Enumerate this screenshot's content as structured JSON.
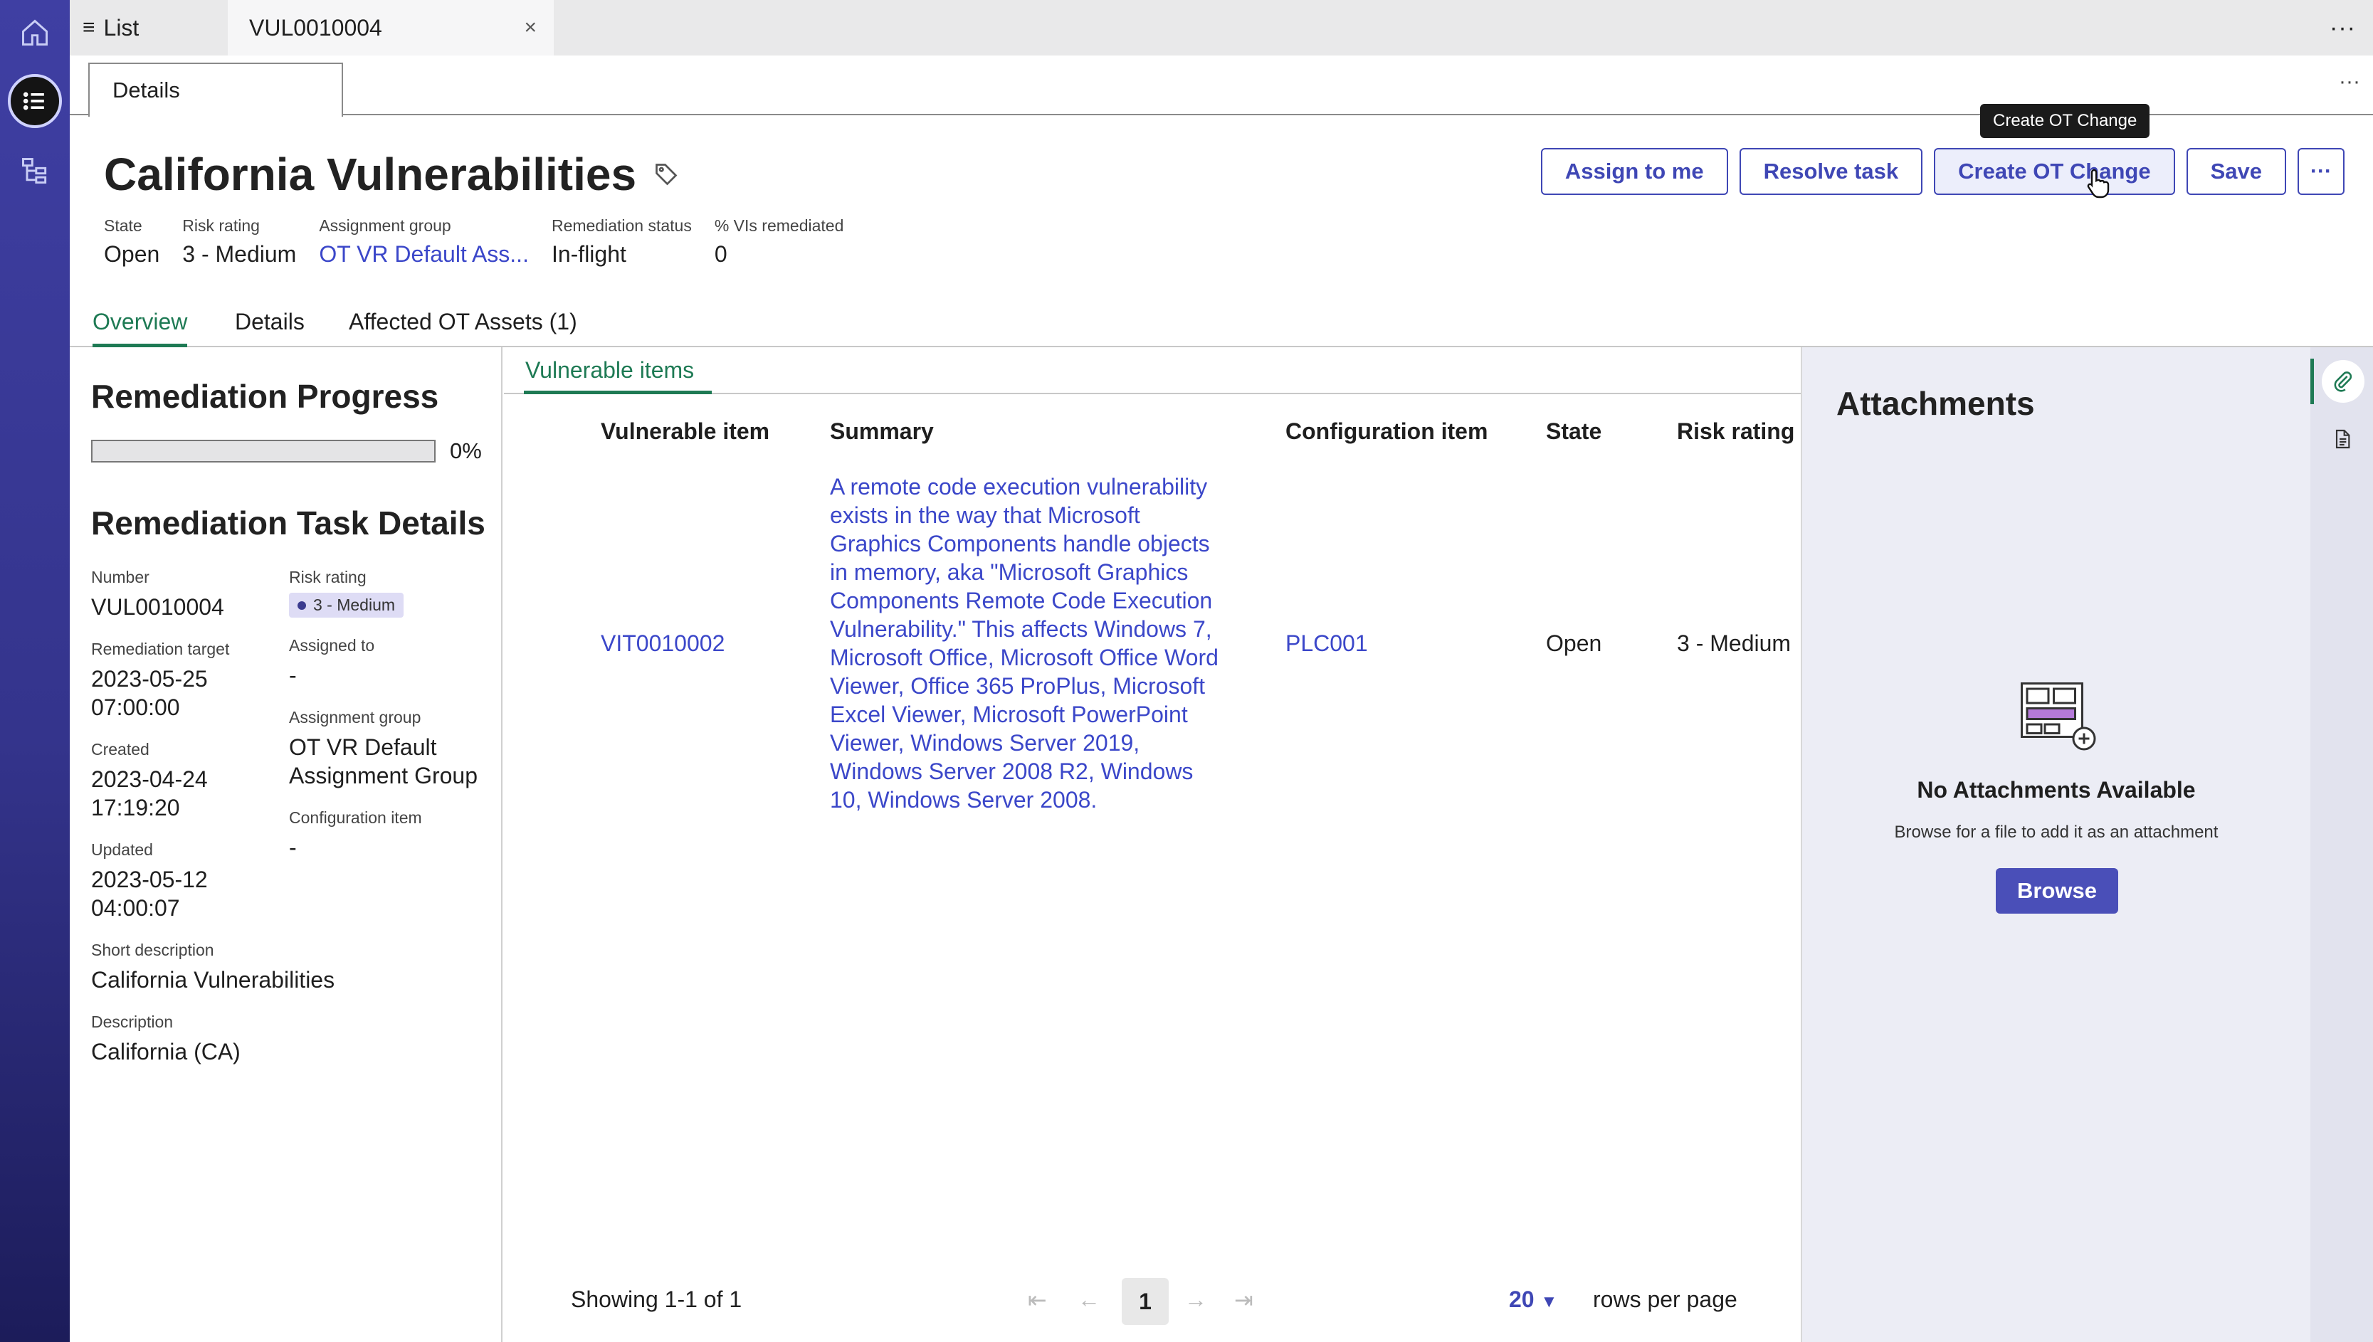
{
  "rail": {
    "items": [
      "home-icon",
      "list-icon",
      "hierarchy-icon"
    ]
  },
  "top_tabs": {
    "list_label": "List",
    "record_label": "VUL0010004",
    "close_glyph": "×",
    "more_glyph": "···"
  },
  "sub_tabs": {
    "details_label": "Details",
    "more_glyph": "···"
  },
  "header": {
    "title": "California Vulnerabilities",
    "fields": [
      {
        "label": "State",
        "value": "Open"
      },
      {
        "label": "Risk rating",
        "value": "3 - Medium"
      },
      {
        "label": "Assignment group",
        "value": "OT VR Default Ass..."
      },
      {
        "label": "Remediation status",
        "value": "In-flight"
      },
      {
        "label": "% VIs remediated",
        "value": "0"
      }
    ]
  },
  "actions": {
    "assign": "Assign to me",
    "resolve": "Resolve task",
    "create_change": "Create OT Change",
    "save": "Save",
    "more": "···",
    "tooltip": "Create OT Change"
  },
  "record_tabs": [
    "Overview",
    "Details",
    "Affected OT Assets (1)"
  ],
  "progress": {
    "title": "Remediation Progress",
    "fraction": 0,
    "percent_label": "0%"
  },
  "task_details": {
    "title": "Remediation Task Details",
    "number_label": "Number",
    "number": "VUL0010004",
    "risk_label": "Risk rating",
    "risk": "3 - Medium",
    "target_label": "Remediation target",
    "target_date": "2023-05-25",
    "target_time": "07:00:00",
    "assigned_label": "Assigned to",
    "assigned": "-",
    "created_label": "Created",
    "created_date": "2023-04-24",
    "created_time": "17:19:20",
    "group_label": "Assignment group",
    "group_line1": "OT VR Default",
    "group_line2": "Assignment Group",
    "ci_label": "Configuration item",
    "ci": "-",
    "updated_label": "Updated",
    "updated_date": "2023-05-12",
    "updated_time": "04:00:07",
    "short_desc_label": "Short description",
    "short_desc": "California Vulnerabilities",
    "desc_label": "Description",
    "desc": "California (CA)"
  },
  "vuln_table": {
    "tab_label": "Vulnerable items",
    "columns": [
      "Vulnerable item",
      "Summary",
      "Configuration item",
      "State",
      "Risk rating"
    ],
    "rows": [
      {
        "item": "VIT0010002",
        "summary": "A remote code execution vulnerability exists in the way that Microsoft Graphics Components handle objects in memory, aka \"Microsoft Graphics Components Remote Code Execution Vulnerability.\" This affects Windows 7, Microsoft Office, Microsoft Office Word Viewer, Office 365 ProPlus, Microsoft Excel Viewer, Microsoft PowerPoint Viewer, Windows Server 2019, Windows Server 2008 R2, Windows 10, Windows Server 2008.",
        "ci": "PLC001",
        "state": "Open",
        "risk": "3 - Medium"
      }
    ],
    "pager": {
      "showing": "Showing 1-1 of 1",
      "page": "1",
      "rows_per_page": "20",
      "rows_per_page_label": "rows per page"
    }
  },
  "attachments": {
    "title": "Attachments",
    "empty_title": "No Attachments Available",
    "empty_hint": "Browse for a file to add it as an attachment",
    "browse": "Browse"
  },
  "colors": {
    "accent": "#3f47b5",
    "link": "#3b47c9",
    "active_tab": "#1e7a54",
    "rail": "#3f3fa3"
  }
}
